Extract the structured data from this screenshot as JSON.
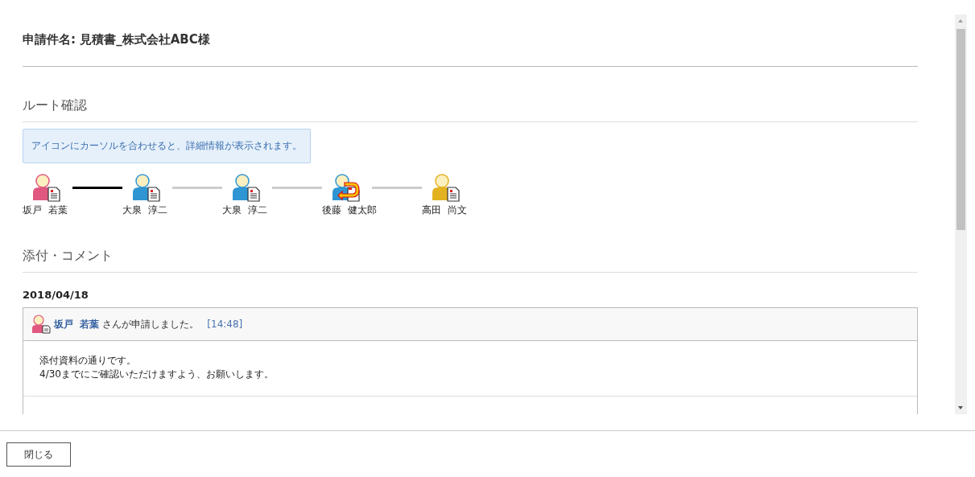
{
  "title": "申請件名: 見積書_株式会社ABC様",
  "route": {
    "heading": "ルート確認",
    "info": "アイコンにカーソルを合わせると、詳細情報が表示されます。",
    "steps": [
      {
        "name": "坂戸  若葉",
        "color": "#e0587f",
        "kind": "document",
        "done": true
      },
      {
        "name": "大泉  淳二",
        "color": "#2f95d3",
        "kind": "document",
        "done": false
      },
      {
        "name": "大泉  淳二",
        "color": "#2f95d3",
        "kind": "document",
        "done": false
      },
      {
        "name": "後藤  健太郎",
        "color": "#2f95d3",
        "kind": "returned",
        "done": false
      },
      {
        "name": "高田  尚文",
        "color": "#e3b220",
        "kind": "document"
      }
    ]
  },
  "comments": {
    "heading": "添付・コメント",
    "date": "2018/04/18",
    "entries": [
      {
        "user": "坂戸  若葉",
        "color": "#e0587f",
        "action": "さんが申請しました。",
        "time": "[14:48]",
        "lines": [
          "添付資料の通りです。",
          "4/30までにご確認いただけますよう、お願いします。"
        ]
      }
    ]
  },
  "footer": {
    "close": "閉じる"
  }
}
